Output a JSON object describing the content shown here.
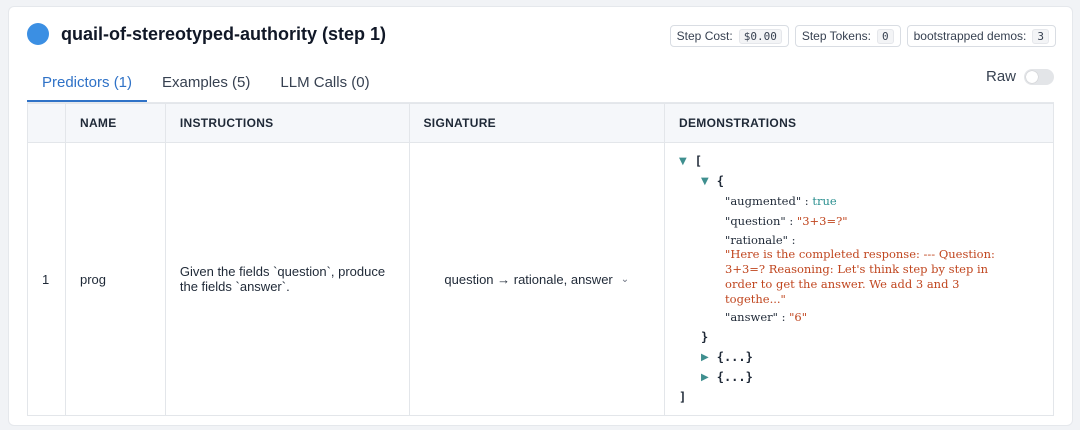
{
  "header": {
    "title": "quail-of-stereotyped-authority (step 1)",
    "badges": [
      {
        "label": "Step Cost:",
        "value": "$0.00"
      },
      {
        "label": "Step Tokens:",
        "value": "0"
      },
      {
        "label": "bootstrapped demos:",
        "value": "3"
      }
    ]
  },
  "tabs": [
    {
      "label": "Predictors (1)",
      "active": true
    },
    {
      "label": "Examples (5)",
      "active": false
    },
    {
      "label": "LLM Calls (0)",
      "active": false
    }
  ],
  "raw_toggle": {
    "label": "Raw",
    "on": false
  },
  "table": {
    "columns": [
      "",
      "NAME",
      "INSTRUCTIONS",
      "SIGNATURE",
      "DEMONSTRATIONS"
    ],
    "rows": [
      {
        "index": "1",
        "name": "prog",
        "instructions": "Given the fields `question`, produce the fields `answer`.",
        "signature": "question → rationale, answer"
      }
    ]
  },
  "demonstrations": {
    "open_bracket": "[",
    "close_bracket": "]",
    "open_brace": "{",
    "close_brace": "}",
    "augmented_key": "\"augmented\" :",
    "augmented_val": "true",
    "question_key": "\"question\" :",
    "question_val": "\"3+3=?\"",
    "rationale_key": "\"rationale\" :",
    "rationale_val": "\"Here is the completed response: --- Question: 3+3=? Reasoning: Let's think step by step in order to get the answer. We add 3 and 3 togethe...\"",
    "answer_key": "\"answer\" :",
    "answer_val": "\"6\"",
    "collapsed_1": "{...}",
    "collapsed_2": "{...}"
  },
  "colors": {
    "accent": "#2f72c7",
    "dot": "#3b8fe3",
    "string": "#c0461f",
    "boolean": "#2a8f8f"
  }
}
